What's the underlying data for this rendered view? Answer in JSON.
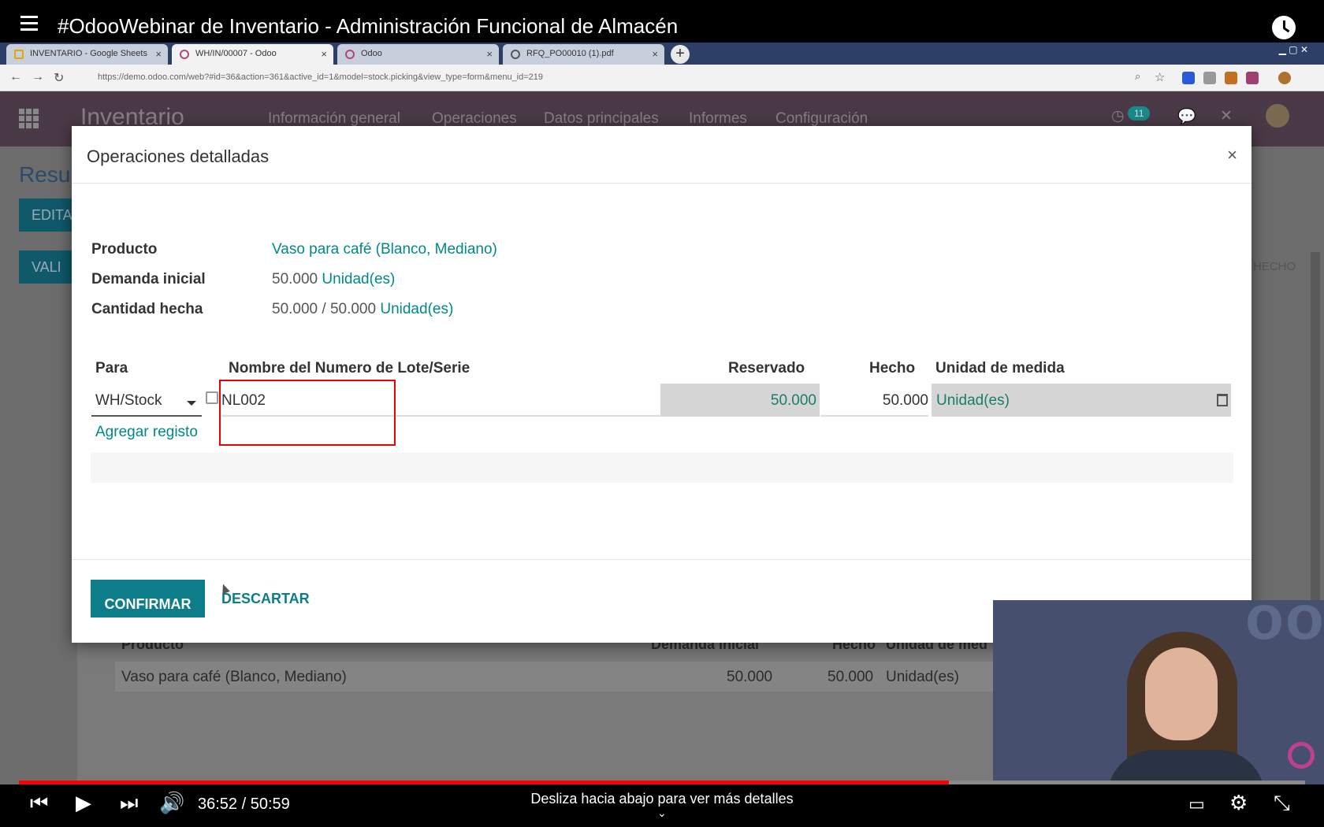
{
  "video": {
    "title": "#OdooWebinar de Inventario - Administración Funcional de Almacén",
    "time_current": "36:52",
    "time_total": "50:59",
    "time_display": "36:52 / 50:59",
    "progress_fraction": 0.723,
    "hint": "Desliza hacia abajo para ver más detalles",
    "colors": {
      "progress": "#ff0000",
      "bar": "#000000"
    }
  },
  "browser": {
    "tabs": [
      {
        "label": "INVENTARIO - Google Sheets"
      },
      {
        "label": "WH/IN/00007 - Odoo"
      },
      {
        "label": "Odoo"
      },
      {
        "label": "RFQ_PO00010 (1).pdf"
      }
    ],
    "url": "https://demo.odoo.com/web?#id=36&action=361&active_id=1&model=stock.picking&view_type=form&menu_id=219"
  },
  "odoo": {
    "app_name": "Inventario",
    "menu": [
      "Información general",
      "Operaciones",
      "Datos principales",
      "Informes",
      "Configuración"
    ],
    "activity_count": "11",
    "background": {
      "title": "Resu",
      "edit_button": "EDITA",
      "validate_button": "VALI",
      "status_hecho": "HECHO",
      "table_headers": [
        "Producto",
        "Demanda inicial",
        "Hecho",
        "Unidad de med"
      ],
      "row": {
        "product": "Vaso para café (Blanco, Mediano)",
        "demand": "50.000",
        "done": "50.000",
        "uom": "Unidad(es)"
      }
    },
    "accent": "#00888a",
    "nav_color": "#4a3a47"
  },
  "modal": {
    "title": "Operaciones detalladas",
    "close": "×",
    "fields": {
      "producto_label": "Producto",
      "producto_value": "Vaso para café (Blanco, Mediano)",
      "demanda_label": "Demanda inicial",
      "demanda_value": "50.000",
      "demanda_uom": "Unidad(es)",
      "cantidad_label": "Cantidad hecha",
      "cantidad_value": "50.000 / 50.000",
      "cantidad_uom": "Unidad(es)"
    },
    "table": {
      "headers": {
        "para": "Para",
        "lot": "Nombre del Numero de Lote/Serie",
        "reservado": "Reservado",
        "hecho": "Hecho",
        "uom": "Unidad de medida"
      },
      "row": {
        "para": "WH/Stock",
        "lot": "NL002",
        "reservado": "50.000",
        "hecho": "50.000",
        "uom": "Unidad(es)"
      },
      "add_line": "Agregar registo"
    },
    "buttons": {
      "confirm": "CONFIRMAR",
      "discard": "DESCARTAR"
    }
  }
}
